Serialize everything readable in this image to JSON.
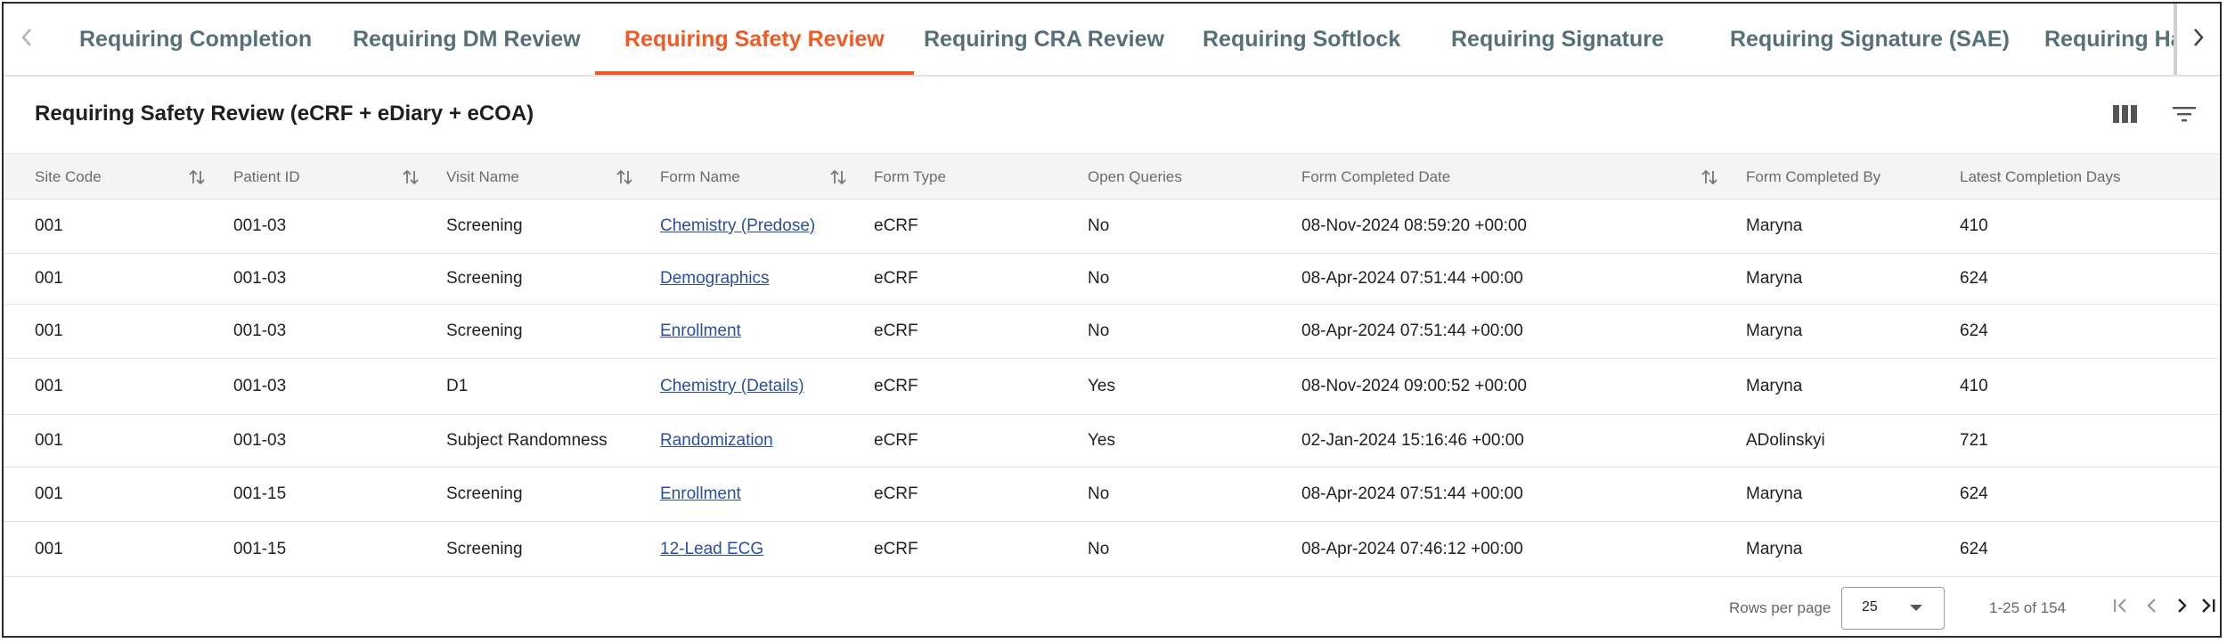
{
  "tabs": [
    {
      "label": "Requiring Completion",
      "active": false
    },
    {
      "label": "Requiring DM Review",
      "active": false
    },
    {
      "label": "Requiring Safety Review",
      "active": true
    },
    {
      "label": "Requiring CRA Review",
      "active": false
    },
    {
      "label": "Requiring Softlock",
      "active": false
    },
    {
      "label": "Requiring Signature",
      "active": false
    },
    {
      "label": "Requiring Signature (SAE)",
      "active": false
    },
    {
      "label": "Requiring Hardl",
      "active": false
    }
  ],
  "icons": {
    "tab_left": "chevron-left-icon",
    "tab_right": "chevron-right-icon",
    "columns": "columns-icon",
    "filter": "filter-icon",
    "sort": "sort-arrows-icon"
  },
  "colors": {
    "active_tab": "#ef5a26",
    "tab_text": "#56707a",
    "link": "#2a4fa0",
    "header_bg": "#f4f4f4"
  },
  "page_title": "Requiring Safety Review (eCRF + eDiary + eCOA)",
  "table": {
    "columns": [
      {
        "label": "Site Code",
        "sortable": true
      },
      {
        "label": "Patient ID",
        "sortable": true
      },
      {
        "label": "Visit Name",
        "sortable": true
      },
      {
        "label": "Form Name",
        "sortable": true
      },
      {
        "label": "Form Type",
        "sortable": false
      },
      {
        "label": "Open Queries",
        "sortable": false
      },
      {
        "label": "Form Completed Date",
        "sortable": true
      },
      {
        "label": "Form Completed By",
        "sortable": false
      },
      {
        "label": "Latest Completion Days",
        "sortable": false
      }
    ],
    "rows": [
      {
        "site": "001",
        "patient": "001-03",
        "visit": "Screening",
        "form": "Chemistry (Predose)",
        "type": "eCRF",
        "queries": "No",
        "date": "08-Nov-2024 08:59:20 +00:00",
        "by": "Maryna",
        "days": "410"
      },
      {
        "site": "001",
        "patient": "001-03",
        "visit": "Screening",
        "form": "Demographics",
        "type": "eCRF",
        "queries": "No",
        "date": "08-Apr-2024 07:51:44 +00:00",
        "by": "Maryna",
        "days": "624"
      },
      {
        "site": "001",
        "patient": "001-03",
        "visit": "Screening",
        "form": "Enrollment",
        "type": "eCRF",
        "queries": "No",
        "date": "08-Apr-2024 07:51:44 +00:00",
        "by": "Maryna",
        "days": "624"
      },
      {
        "site": "001",
        "patient": "001-03",
        "visit": "D1",
        "form": "Chemistry (Details)",
        "type": "eCRF",
        "queries": "Yes",
        "date": "08-Nov-2024 09:00:52 +00:00",
        "by": "Maryna",
        "days": "410"
      },
      {
        "site": "001",
        "patient": "001-03",
        "visit": "Subject Randomness",
        "form": "Randomization",
        "type": "eCRF",
        "queries": "Yes",
        "date": "02-Jan-2024 15:16:46 +00:00",
        "by": "ADolinskyi",
        "days": "721"
      },
      {
        "site": "001",
        "patient": "001-15",
        "visit": "Screening",
        "form": "Enrollment",
        "type": "eCRF",
        "queries": "No",
        "date": "08-Apr-2024 07:51:44 +00:00",
        "by": "Maryna",
        "days": "624"
      },
      {
        "site": "001",
        "patient": "001-15",
        "visit": "Screening",
        "form": "12-Lead ECG",
        "type": "eCRF",
        "queries": "No",
        "date": "08-Apr-2024 07:46:12 +00:00",
        "by": "Maryna",
        "days": "624"
      }
    ]
  },
  "pagination": {
    "rows_per_page_label": "Rows per page",
    "rows_per_page_value": "25",
    "range_text": "1-25 of 154"
  }
}
